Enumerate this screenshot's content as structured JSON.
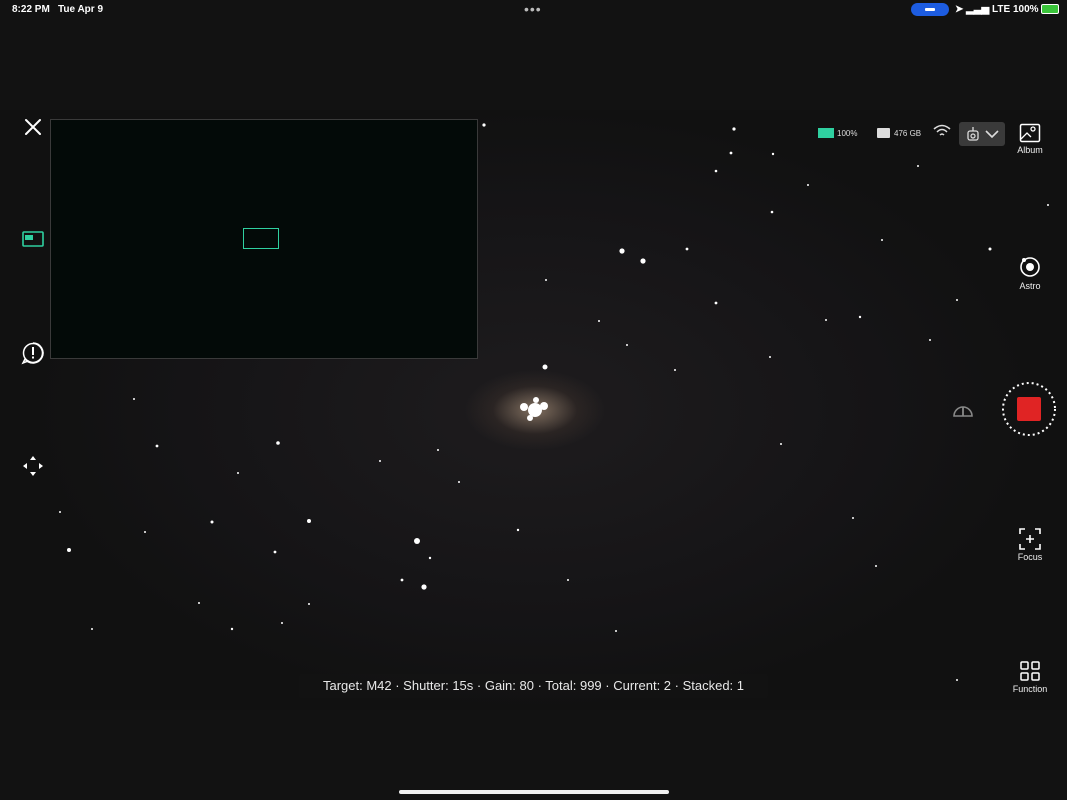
{
  "status_bar": {
    "time": "8:22 PM",
    "date": "Tue Apr 9",
    "multitask_dots": "•••",
    "right": "LTE 100%"
  },
  "camera": {
    "battery": "100%",
    "storage": "476 GB",
    "album_label": "Album",
    "astro_label": "Astro",
    "focus_label": "Focus",
    "function_label": "Function"
  },
  "info_bar": {
    "text": "Target: M42 · Shutter: 15s · Gain: 80 · Total: 999 · Current: 2 · Stacked: 1"
  },
  "colors": {
    "accent": "#2fd0a0",
    "record": "#e02424",
    "status_pill": "#1d5ce0"
  }
}
